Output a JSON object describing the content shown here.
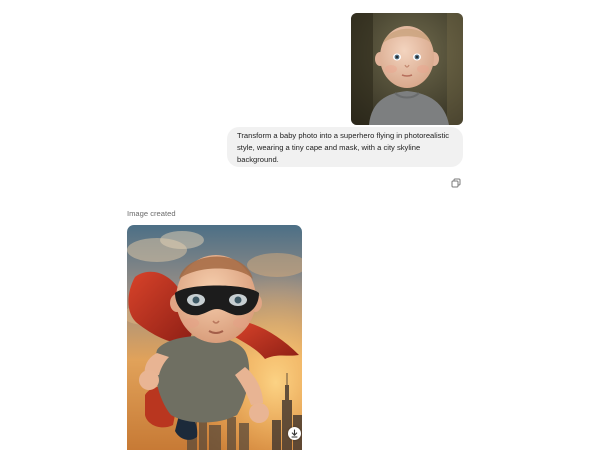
{
  "conversation": {
    "user_message": {
      "image_alt": "baby photo",
      "text": "Transform a baby photo into a superhero flying in photorealistic style, wearing a tiny cape and mask, with a city skyline background."
    },
    "user_actions": {
      "copy_icon": "copy-icon"
    },
    "assistant_message": {
      "status_label": "Image created",
      "image_alt": "baby superhero flying with red cape and black mask over city skyline",
      "download_icon": "download-icon"
    }
  },
  "colors": {
    "bubble_bg": "#f1f1f1",
    "label_text": "#6b6b6b",
    "cape_red": "#c6321f",
    "mask_black": "#1c1c1c",
    "sky_orange": "#e89a4a"
  }
}
